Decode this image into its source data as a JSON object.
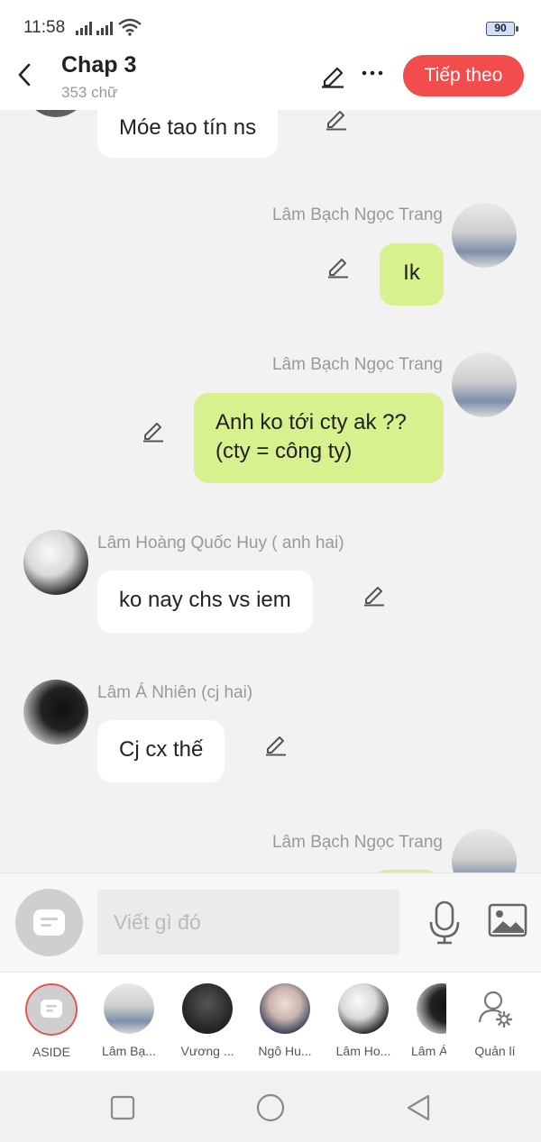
{
  "status_bar": {
    "time": "11:58",
    "battery": "90"
  },
  "header": {
    "title": "Chap 3",
    "subtitle": "353 chữ",
    "next_label": "Tiếp theo"
  },
  "messages": [
    {
      "speaker": "",
      "text": "Móe tao tín ns",
      "side": "left"
    },
    {
      "speaker": "Lâm Bạch Ngọc Trang",
      "text": "Ik",
      "side": "right"
    },
    {
      "speaker": "Lâm Bạch Ngọc Trang",
      "text": "Anh ko tới cty ak ??\n(cty = công ty)",
      "side": "right"
    },
    {
      "speaker": "Lâm Hoàng Quốc Huy ( anh hai)",
      "text": "ko nay chs vs iem",
      "side": "left"
    },
    {
      "speaker": "Lâm Á Nhiên (cj hai)",
      "text": "Cj cx thế",
      "side": "left"
    },
    {
      "speaker": "Lâm Bạch Ngọc Trang",
      "text": "",
      "side": "right"
    }
  ],
  "composer": {
    "placeholder": "Viết gì đó"
  },
  "characters": [
    {
      "label": "ASIDE"
    },
    {
      "label": "Lâm Bạ..."
    },
    {
      "label": "Vương ..."
    },
    {
      "label": "Ngô Hu..."
    },
    {
      "label": "Lâm Ho..."
    },
    {
      "label": "Lâm Á"
    },
    {
      "label": "Quản lí"
    }
  ],
  "colors": {
    "accent": "#f24c4c",
    "my_bubble": "#d6f18e",
    "other_bubble": "#ffffff",
    "background": "#f2f2f2"
  },
  "icons": [
    "back-arrow-icon",
    "pencil-icon",
    "more-dots-icon",
    "microphone-icon",
    "image-icon",
    "manage-user-icon",
    "square-icon",
    "circle-icon",
    "triangle-back-icon"
  ]
}
